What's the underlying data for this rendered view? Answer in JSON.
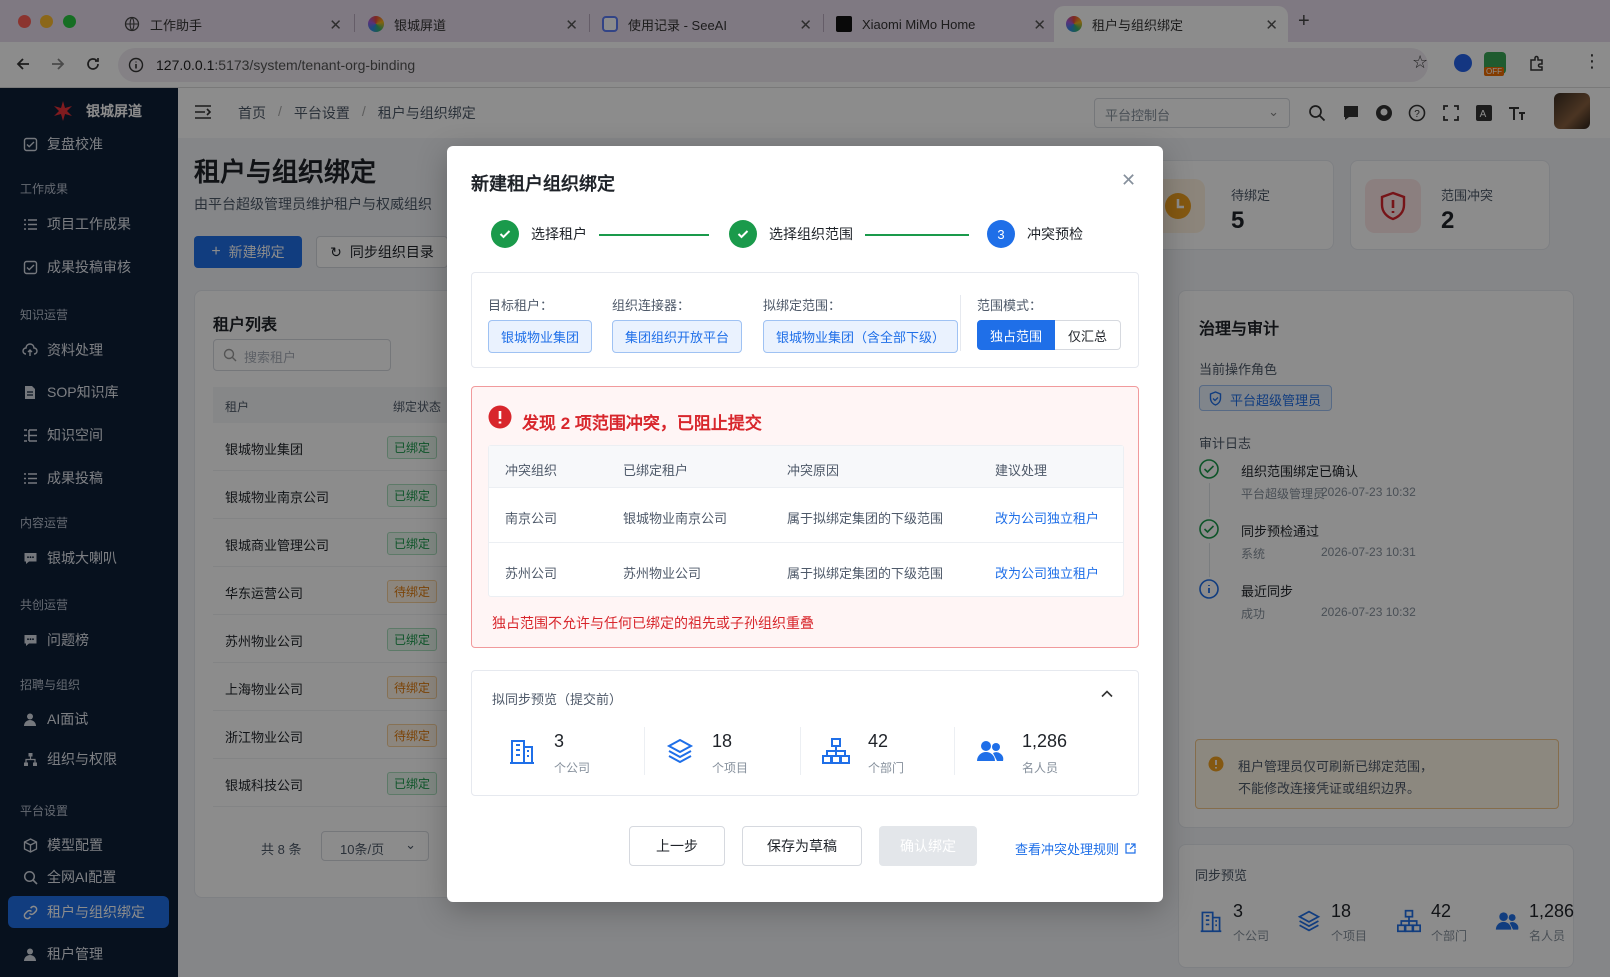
{
  "browser": {
    "tabs": [
      {
        "title": "工作助手"
      },
      {
        "title": "银城屏道"
      },
      {
        "title": "使用记录 - SeeAI"
      },
      {
        "title": "Xiaomi MiMo Home"
      },
      {
        "title": "租户与组织绑定"
      }
    ],
    "url_host": "127.0.0.1",
    "url_path": ":5173/system/tenant-org-binding",
    "ext_badge": "OFF"
  },
  "sidebar": {
    "logo": "银城屏道",
    "groups": {
      "g1": "工作成果",
      "g2": "知识运营",
      "g3": "内容运营",
      "g4": "共创运营",
      "g5": "招聘与组织",
      "g6": "平台设置"
    },
    "items": {
      "fupan": "复盘校准",
      "xiangmu": "项目工作成果",
      "shenhe": "成果投稿审核",
      "ziliao": "资料处理",
      "sop": "SOP知识库",
      "kongjian": "知识空间",
      "tougao": "成果投稿",
      "laba": "银城大喇叭",
      "wenti": "问题榜",
      "ai": "AI面试",
      "zuzhi": "组织与权限",
      "moxing": "模型配置",
      "quanwang": "全网AI配置",
      "bangding": "租户与组织绑定",
      "zuhu": "租户管理"
    }
  },
  "header": {
    "breadcrumb": [
      "首页",
      "平台设置",
      "租户与组织绑定"
    ],
    "workspace_select": "平台控制台"
  },
  "page": {
    "title": "租户与组织绑定",
    "subtitle": "由平台超级管理员维护租户与权威组织",
    "new_button": "新建绑定",
    "sync_button": "同步组织目录",
    "kpis": [
      {
        "label": "待绑定",
        "value": "5"
      },
      {
        "label": "范围冲突",
        "value": "2"
      }
    ],
    "tenant_list": {
      "title": "租户列表",
      "search_placeholder": "搜索租户",
      "columns": [
        "租户",
        "绑定状态"
      ],
      "rows": [
        {
          "name": "银城物业集团",
          "status": "已绑定",
          "kind": "ok"
        },
        {
          "name": "银城物业南京公司",
          "status": "已绑定",
          "kind": "ok"
        },
        {
          "name": "银城商业管理公司",
          "status": "已绑定",
          "kind": "ok"
        },
        {
          "name": "华东运营公司",
          "status": "待绑定",
          "kind": "wait"
        },
        {
          "name": "苏州物业公司",
          "status": "已绑定",
          "kind": "ok"
        },
        {
          "name": "上海物业公司",
          "status": "待绑定",
          "kind": "wait"
        },
        {
          "name": "浙江物业公司",
          "status": "待绑定",
          "kind": "wait"
        },
        {
          "name": "银城科技公司",
          "status": "已绑定",
          "kind": "ok"
        }
      ],
      "total": "共 8 条",
      "page_size": "10条/页"
    },
    "governance": {
      "title": "治理与审计",
      "role_label": "当前操作角色",
      "role": "平台超级管理员",
      "log_label": "审计日志",
      "logs": [
        {
          "title": "组织范围绑定已确认",
          "who": "平台超级管理员",
          "time": "2026-07-23 10:32"
        },
        {
          "title": "同步预检通过",
          "who": "系统",
          "time": "2026-07-23 10:31"
        },
        {
          "title": "最近同步",
          "who": "成功",
          "time": "2026-07-23 10:32"
        }
      ],
      "notice_line1": "租户管理员仅可刷新已绑定范围，",
      "notice_line2": "不能修改连接凭证或组织边界。"
    },
    "sync_preview": {
      "title": "同步预览",
      "stats": [
        {
          "num": "3",
          "label": "个公司"
        },
        {
          "num": "18",
          "label": "个项目"
        },
        {
          "num": "42",
          "label": "个部门"
        },
        {
          "num": "1,286",
          "label": "名人员"
        }
      ]
    }
  },
  "modal": {
    "title": "新建租户组织绑定",
    "steps": [
      {
        "label": "选择租户",
        "state": "done"
      },
      {
        "label": "选择组织范围",
        "state": "done"
      },
      {
        "label": "冲突预检",
        "state": "current",
        "num": "3"
      }
    ],
    "summary": {
      "target_label": "目标租户：",
      "target_value": "银城物业集团",
      "connector_label": "组织连接器：",
      "connector_value": "集团组织开放平台",
      "scope_label": "拟绑定范围：",
      "scope_value": "银城物业集团（含全部下级）",
      "mode_label": "范围模式：",
      "mode_options": [
        "独占范围",
        "仅汇总"
      ],
      "mode_selected": "独占范围"
    },
    "conflict": {
      "title": "发现 2 项范围冲突，已阻止提交",
      "columns": [
        "冲突组织",
        "已绑定租户",
        "冲突原因",
        "建议处理"
      ],
      "rows": [
        {
          "org": "南京公司",
          "tenant": "银城物业南京公司",
          "reason": "属于拟绑定集团的下级范围",
          "action": "改为公司独立租户"
        },
        {
          "org": "苏州公司",
          "tenant": "苏州物业公司",
          "reason": "属于拟绑定集团的下级范围",
          "action": "改为公司独立租户"
        }
      ],
      "note": "独占范围不允许与任何已绑定的祖先或子孙组织重叠"
    },
    "preview": {
      "title": "拟同步预览（提交前）",
      "stats": [
        {
          "num": "3",
          "label": "个公司"
        },
        {
          "num": "18",
          "label": "个项目"
        },
        {
          "num": "42",
          "label": "个部门"
        },
        {
          "num": "1,286",
          "label": "名人员"
        }
      ]
    },
    "buttons": {
      "prev": "上一步",
      "draft": "保存为草稿",
      "confirm": "确认绑定",
      "rules_link": "查看冲突处理规则"
    }
  },
  "colors": {
    "primary": "#1f6fe8",
    "success": "#1a9a4b",
    "danger": "#d8262c",
    "warning": "#e07d10",
    "sidebar": "#0e1f38"
  }
}
